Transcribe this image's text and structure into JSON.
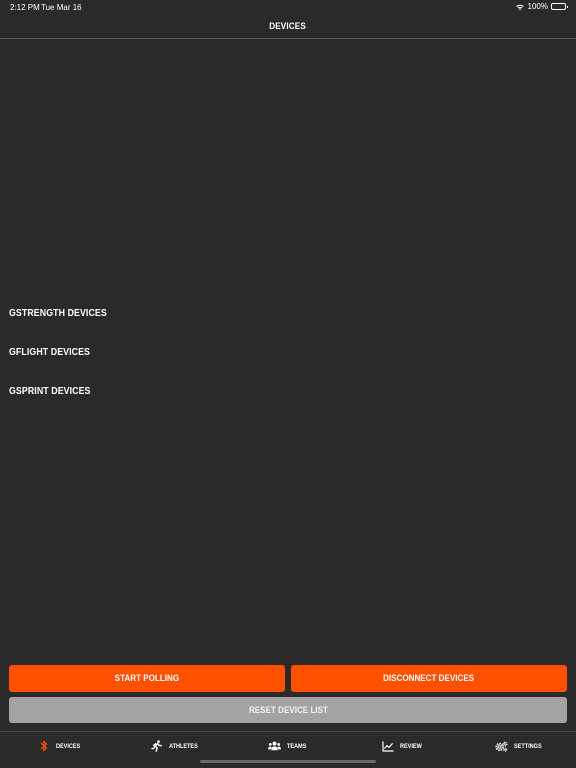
{
  "status_bar": {
    "time": "2:12 PM",
    "date": "Tue Mar 16",
    "battery": "100%",
    "wifi_icon": "wifi-icon",
    "battery_icon": "battery-icon"
  },
  "nav": {
    "title": "DEVICES"
  },
  "sections": {
    "gstrength": "GSTRENGTH DEVICES",
    "gflight": "GFLIGHT DEVICES",
    "gsprint": "GSPRINT DEVICES"
  },
  "buttons": {
    "start_polling": "START POLLING",
    "disconnect": "DISCONNECT DEVICES",
    "reset": "RESET DEVICE LIST"
  },
  "tabs": [
    {
      "label": "DEVICES",
      "icon": "bluetooth-icon",
      "active": true
    },
    {
      "label": "ATHLETES",
      "icon": "running-person-icon",
      "active": false
    },
    {
      "label": "TEAMS",
      "icon": "users-icon",
      "active": false
    },
    {
      "label": "REVIEW",
      "icon": "chart-line-icon",
      "active": false
    },
    {
      "label": "SETTINGS",
      "icon": "gears-icon",
      "active": false
    }
  ],
  "colors": {
    "background": "#2a2a2a",
    "accent": "#ff4f00",
    "button_gray": "#a3a3a3"
  }
}
